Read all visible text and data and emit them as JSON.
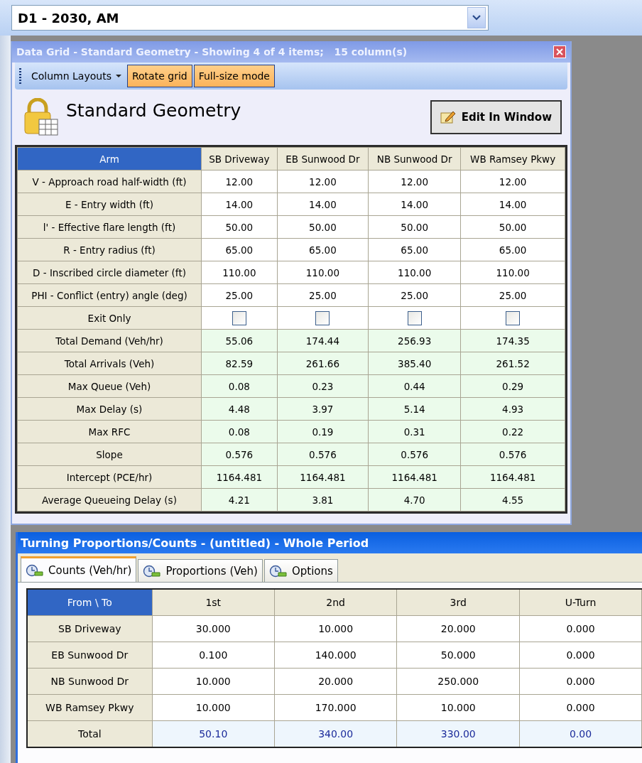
{
  "scenario_select": {
    "value": "D1 - 2030, AM"
  },
  "data_grid": {
    "title": "Data Grid - Standard Geometry - Showing 4 of 4 items;   15 column(s)",
    "toolbar": [
      "Column Layouts",
      "Rotate grid",
      "Full-size mode"
    ],
    "heading": "Standard Geometry",
    "edit_button": "Edit In Window",
    "columns": [
      "Arm",
      "SB Driveway",
      "EB Sunwood Dr",
      "NB Sunwood Dr",
      "WB Ramsey Pkwy"
    ],
    "rows": [
      {
        "kind": "input",
        "label": "V - Approach road half-width (ft)",
        "values": [
          "12.00",
          "12.00",
          "12.00",
          "12.00"
        ]
      },
      {
        "kind": "input",
        "label": "E - Entry width (ft)",
        "values": [
          "14.00",
          "14.00",
          "14.00",
          "14.00"
        ]
      },
      {
        "kind": "input",
        "label": "l' - Effective flare length (ft)",
        "values": [
          "50.00",
          "50.00",
          "50.00",
          "50.00"
        ]
      },
      {
        "kind": "input",
        "label": "R - Entry radius (ft)",
        "values": [
          "65.00",
          "65.00",
          "65.00",
          "65.00"
        ]
      },
      {
        "kind": "input",
        "label": "D - Inscribed circle diameter (ft)",
        "values": [
          "110.00",
          "110.00",
          "110.00",
          "110.00"
        ]
      },
      {
        "kind": "input",
        "label": "PHI - Conflict (entry) angle (deg)",
        "values": [
          "25.00",
          "25.00",
          "25.00",
          "25.00"
        ]
      },
      {
        "kind": "checkbox",
        "label": "Exit Only",
        "checked": [
          false,
          false,
          false,
          false
        ]
      },
      {
        "kind": "result",
        "label": "Total Demand (Veh/hr)",
        "values": [
          "55.06",
          "174.44",
          "256.93",
          "174.35"
        ]
      },
      {
        "kind": "result",
        "label": "Total Arrivals (Veh)",
        "values": [
          "82.59",
          "261.66",
          "385.40",
          "261.52"
        ]
      },
      {
        "kind": "result",
        "label": "Max Queue (Veh)",
        "values": [
          "0.08",
          "0.23",
          "0.44",
          "0.29"
        ]
      },
      {
        "kind": "result",
        "label": "Max Delay (s)",
        "values": [
          "4.48",
          "3.97",
          "5.14",
          "4.93"
        ]
      },
      {
        "kind": "result",
        "label": "Max RFC",
        "values": [
          "0.08",
          "0.19",
          "0.31",
          "0.22"
        ]
      },
      {
        "kind": "result",
        "label": "Slope",
        "values": [
          "0.576",
          "0.576",
          "0.576",
          "0.576"
        ]
      },
      {
        "kind": "result",
        "label": "Intercept (PCE/hr)",
        "values": [
          "1164.481",
          "1164.481",
          "1164.481",
          "1164.481"
        ]
      },
      {
        "kind": "result",
        "label": "Average Queueing Delay (s)",
        "values": [
          "4.21",
          "3.81",
          "4.70",
          "4.55"
        ]
      }
    ]
  },
  "turning": {
    "title": "Turning Proportions/Counts - (untitled) - Whole Period",
    "tabs": [
      {
        "label": "Counts (Veh/hr)",
        "selected": true
      },
      {
        "label": "Proportions (Veh)",
        "selected": false
      },
      {
        "label": "Options",
        "selected": false
      }
    ],
    "columns": [
      "From \\ To",
      "1st",
      "2nd",
      "3rd",
      "U-Turn"
    ],
    "rows": [
      {
        "kind": "count",
        "label": "SB Driveway",
        "values": [
          "30.000",
          "10.000",
          "20.000",
          "0.000"
        ]
      },
      {
        "kind": "count",
        "label": "EB Sunwood Dr",
        "values": [
          "0.100",
          "140.000",
          "50.000",
          "0.000"
        ]
      },
      {
        "kind": "count",
        "label": "NB Sunwood Dr",
        "values": [
          "10.000",
          "20.000",
          "250.000",
          "0.000"
        ]
      },
      {
        "kind": "count",
        "label": "WB Ramsey Pkwy",
        "values": [
          "10.000",
          "170.000",
          "10.000",
          "0.000"
        ]
      },
      {
        "kind": "total",
        "label": "Total",
        "values": [
          "50.10",
          "340.00",
          "330.00",
          "0.00"
        ]
      }
    ]
  }
}
